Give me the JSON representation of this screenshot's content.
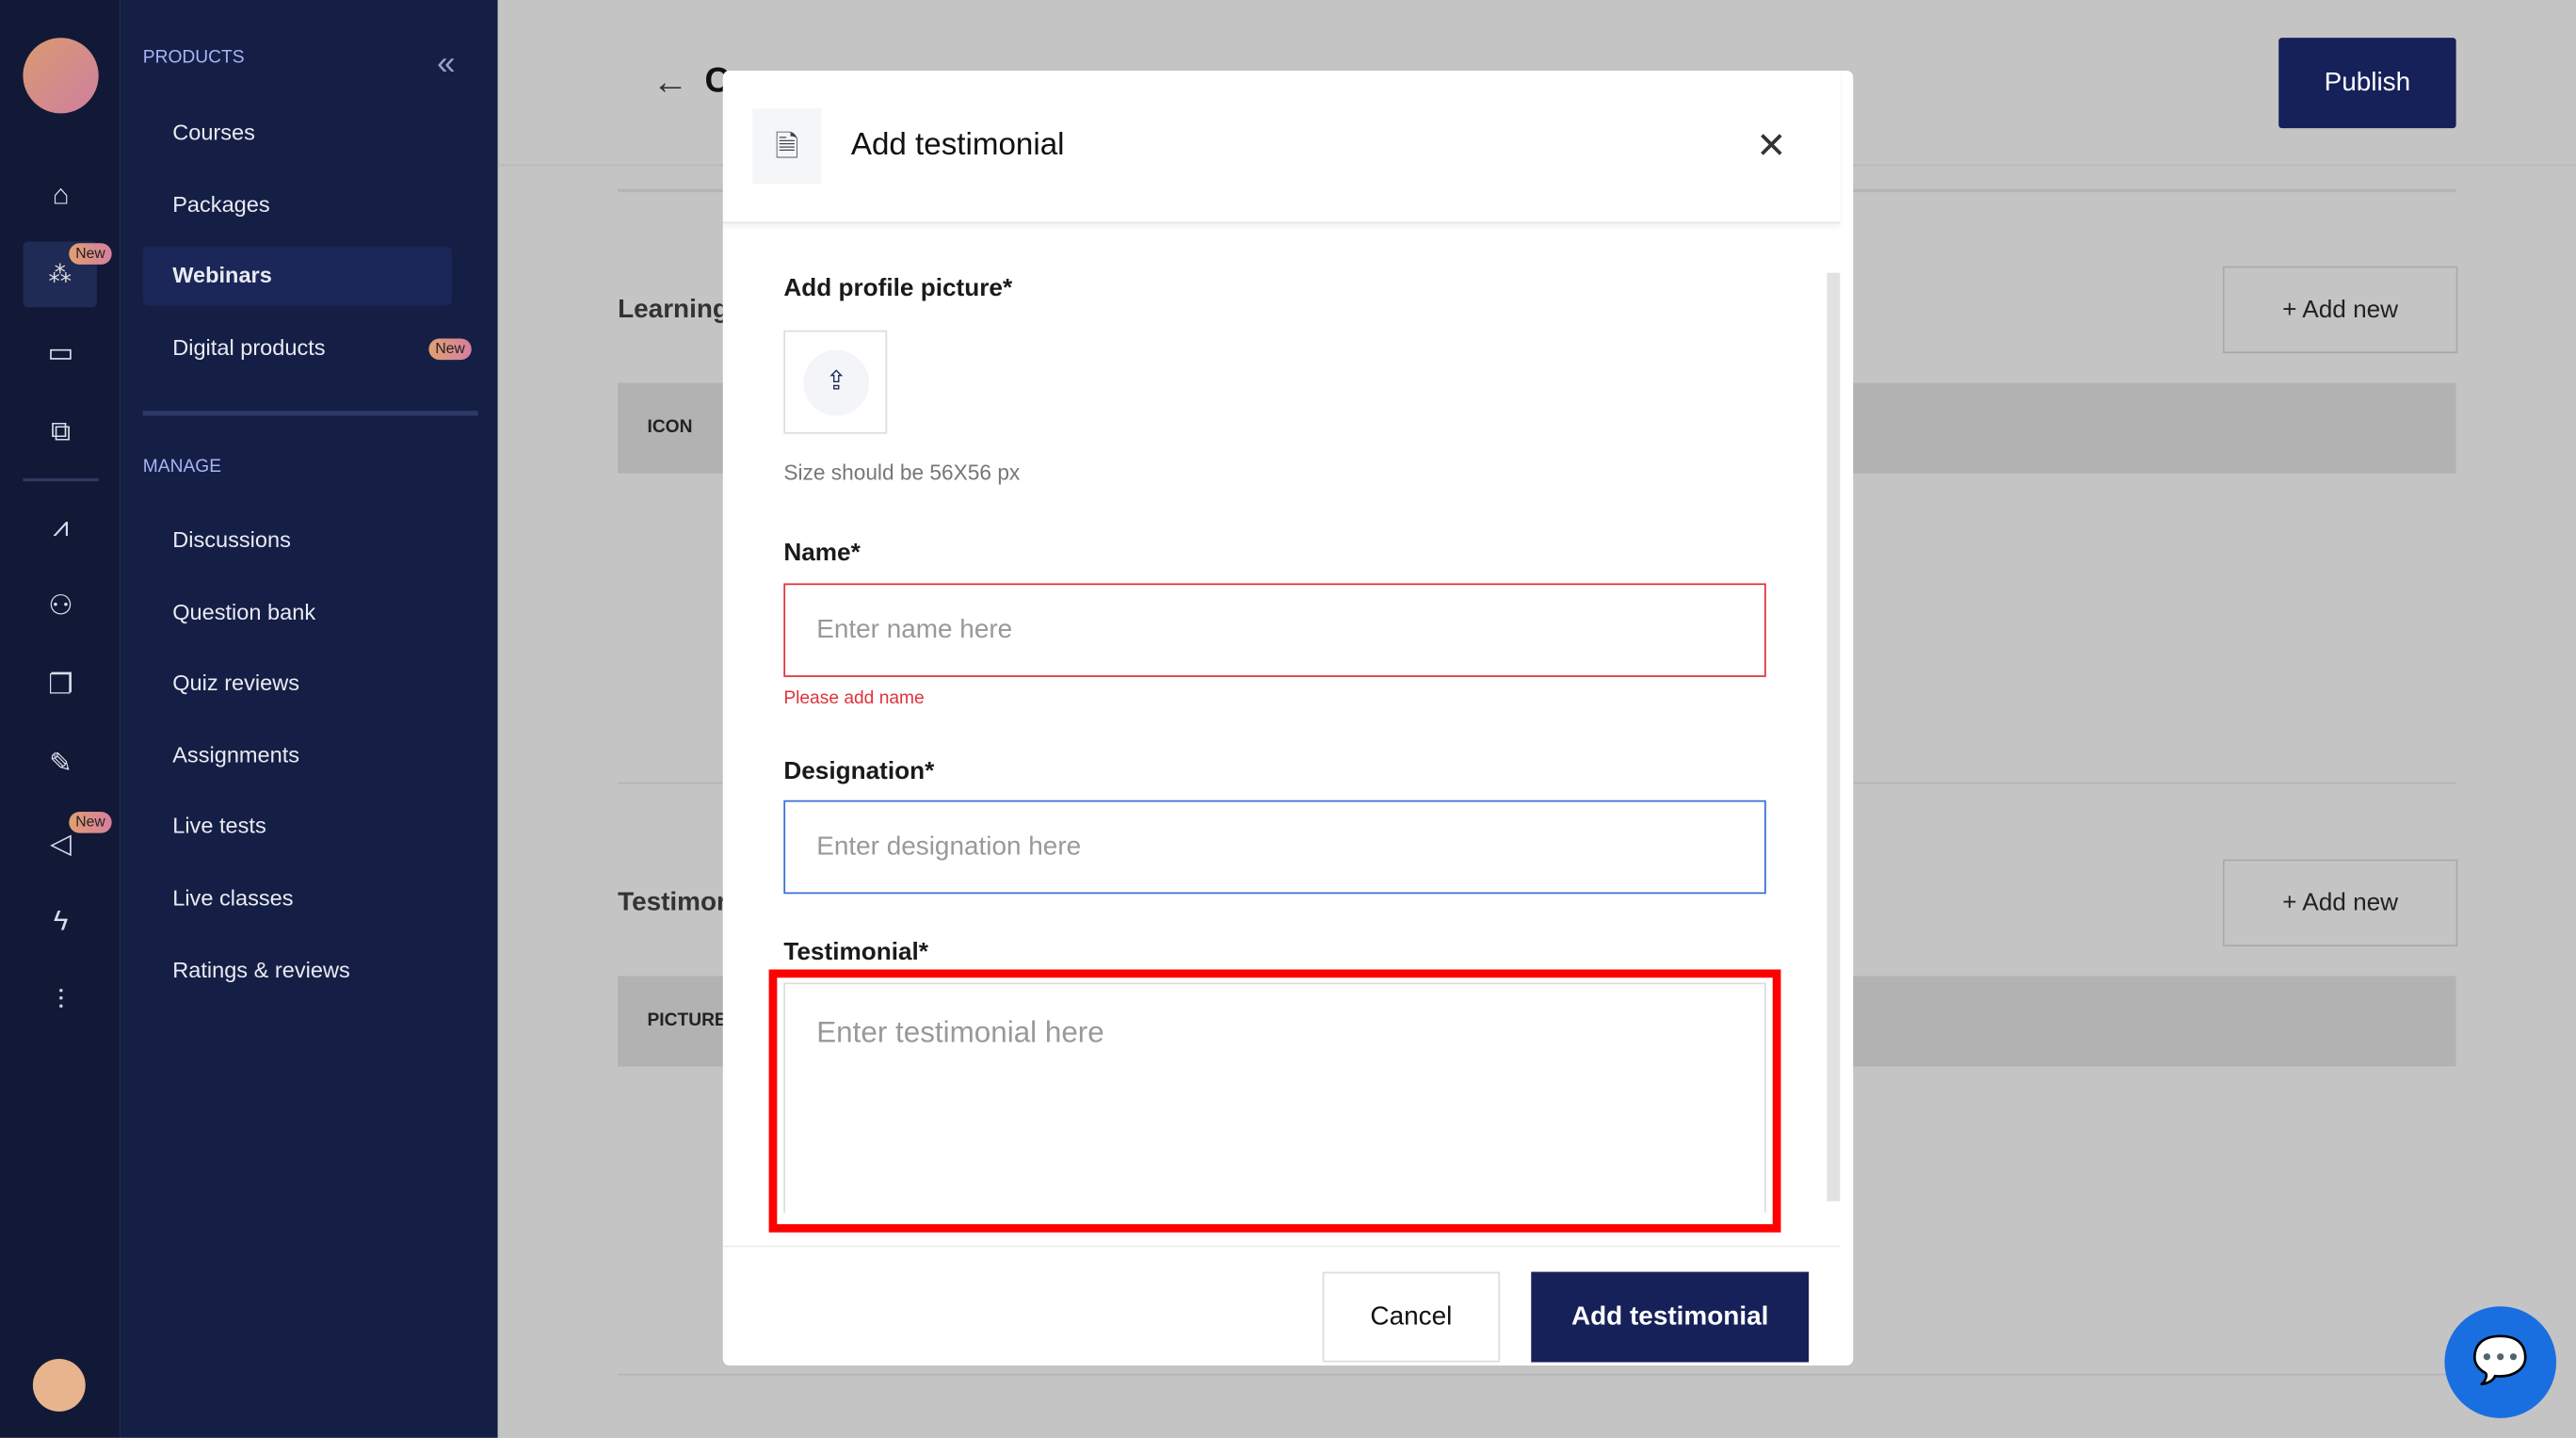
{
  "rail": {
    "icons": [
      "logo",
      "home-icon",
      "webinars-icon",
      "ticket-icon",
      "chat-icon",
      "analytics-icon",
      "users-icon",
      "copy-icon",
      "tools-icon",
      "megaphone-icon",
      "bolt-icon",
      "settings-sliders-icon",
      "avatar"
    ],
    "new_badge": "New"
  },
  "sidebar": {
    "products_label": "PRODUCTS",
    "manage_label": "MANAGE",
    "products": [
      {
        "label": "Courses"
      },
      {
        "label": "Packages"
      },
      {
        "label": "Webinars",
        "active": true
      },
      {
        "label": "Digital products",
        "badge": "New"
      }
    ],
    "manage": [
      {
        "label": "Discussions"
      },
      {
        "label": "Question bank"
      },
      {
        "label": "Quiz reviews"
      },
      {
        "label": "Assignments"
      },
      {
        "label": "Live tests"
      },
      {
        "label": "Live classes"
      },
      {
        "label": "Ratings & reviews"
      }
    ]
  },
  "main": {
    "title_partial": "C",
    "publish": "Publish",
    "learning": "Learning",
    "add_new": "Add new",
    "icon_col": "ICON",
    "testimonials": "Testimor",
    "picture_col": "PICTURE"
  },
  "modal": {
    "title": "Add testimonial",
    "profile_label": "Add profile picture*",
    "size_hint": "Size should be 56X56 px",
    "name_label": "Name*",
    "name_placeholder": "Enter name here",
    "name_error": "Please add name",
    "designation_label": "Designation*",
    "designation_placeholder": "Enter designation here",
    "testimonial_label": "Testimonial*",
    "testimonial_placeholder": "Enter testimonial here",
    "cancel": "Cancel",
    "submit": "Add testimonial"
  },
  "colors": {
    "primary": "#16215a",
    "error": "#e0323c",
    "focus": "#3a6fd8",
    "highlight": "#ff0000"
  }
}
